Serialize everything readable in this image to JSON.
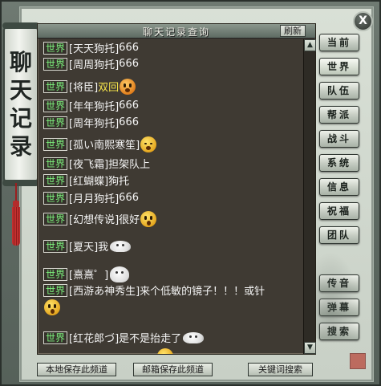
{
  "side_scroll": {
    "title": "聊天记录"
  },
  "close": {
    "label": "X"
  },
  "panel": {
    "title": "聊天记录查询",
    "refresh_label": "刷新"
  },
  "messages": [
    {
      "channel": "世界",
      "speaker": "[天天狗托]",
      "text": "666"
    },
    {
      "channel": "世界",
      "speaker": "[周周狗托]",
      "text": "666"
    },
    {
      "channel": "世界",
      "speaker": "[将臣]",
      "text": "双回",
      "emote": "angry-face"
    },
    {
      "channel": "世界",
      "speaker": "[年年狗托]",
      "text": "666"
    },
    {
      "channel": "世界",
      "speaker": "[周年狗托]",
      "text": "666"
    },
    {
      "channel": "世界",
      "speaker": "[孤い南熙寒笙]",
      "text": "",
      "emote": "yawn-face"
    },
    {
      "channel": "世界",
      "speaker": "[夜飞霜]",
      "text": "担架队上"
    },
    {
      "channel": "世界",
      "speaker": "[红蝴蝶]",
      "text": "狗托"
    },
    {
      "channel": "世界",
      "speaker": "[月月狗托]",
      "text": "666"
    },
    {
      "channel": "世界",
      "speaker": "[幻想传说]",
      "text": "很好",
      "emote": "surprised-face"
    },
    {
      "channel": "世界",
      "speaker": "[夏天]",
      "text": "我",
      "emote": "bun-face"
    },
    {
      "channel": "世界",
      "speaker": "[熹熹゜]",
      "text": "",
      "emote": "bun-face"
    },
    {
      "channel": "世界",
      "speaker": "[西游あ神秀生]",
      "text": "来个低敏的镜子！！！或针"
    },
    {
      "channel": "",
      "speaker": "",
      "text": "",
      "emote": "surprised-face"
    },
    {
      "channel": "世界",
      "speaker": "[红花郎づ]",
      "text": "是不是抬走了",
      "emote": "bun-face"
    }
  ],
  "side_buttons": [
    {
      "label": "当前"
    },
    {
      "label": "世界"
    },
    {
      "label": "队伍"
    },
    {
      "label": "帮派"
    },
    {
      "label": "战斗"
    },
    {
      "label": "系统"
    },
    {
      "label": "信息"
    },
    {
      "label": "祝福"
    },
    {
      "label": "团队"
    },
    {
      "label": "传音"
    },
    {
      "label": "弹幕"
    },
    {
      "label": "搜索"
    }
  ],
  "bottom_buttons": [
    {
      "label": "本地保存此频道"
    },
    {
      "label": "邮箱保存此频道"
    },
    {
      "label": "关键词搜索"
    }
  ],
  "colors": {
    "channel_tag": "#7cf07c",
    "highlight_text": "#f3e24a",
    "chat_background": "#3f3a33"
  }
}
